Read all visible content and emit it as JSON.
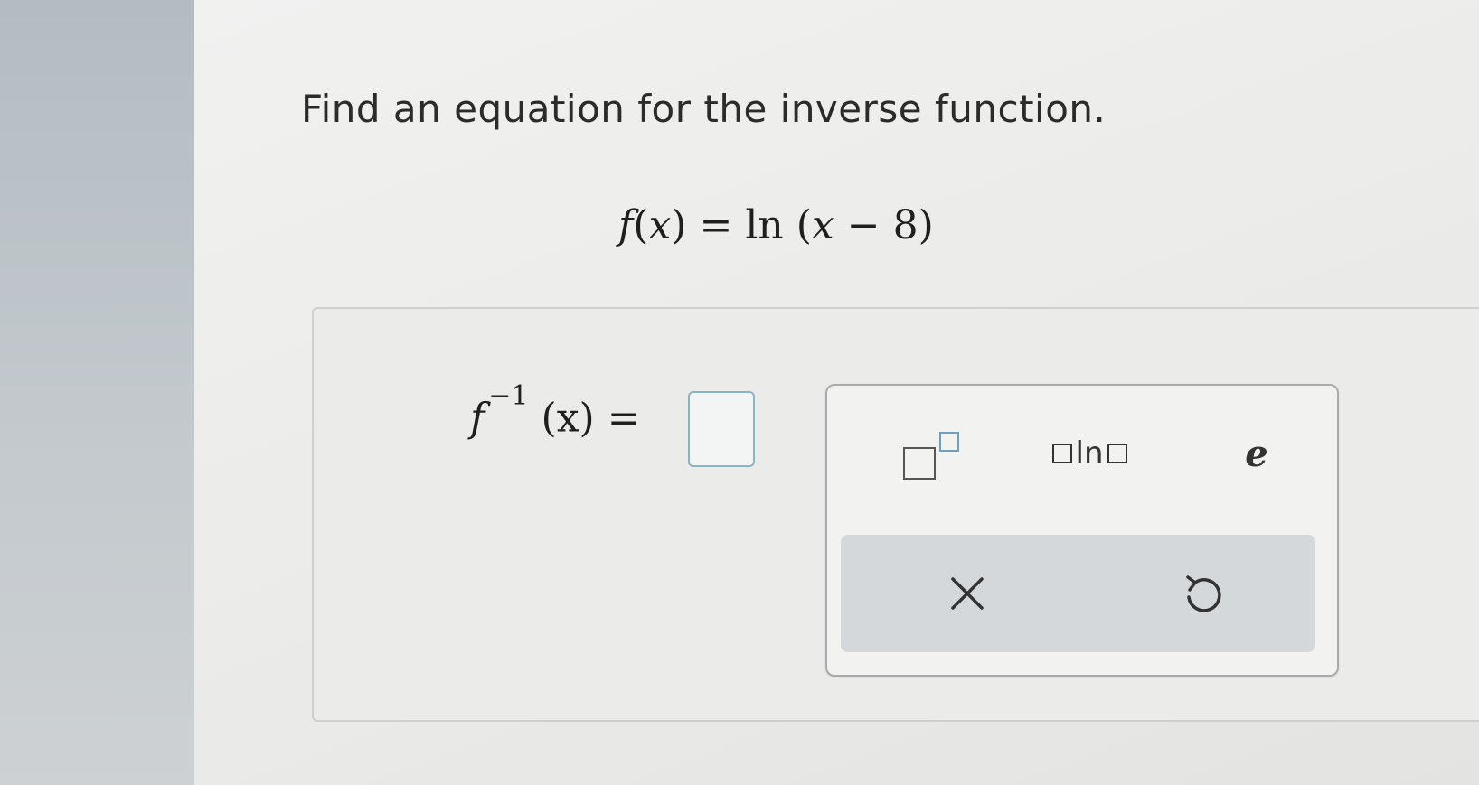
{
  "question": {
    "text": "Find an equation for the inverse function."
  },
  "given": {
    "f": "f",
    "lparen": "(",
    "x": "x",
    "rparen": ")",
    "equals": " = ",
    "ln": "ln",
    "lparen2": " (",
    "x2": "x",
    "minus": " − ",
    "eight": "8",
    "rparen2": ")"
  },
  "answer": {
    "f": "f",
    "exponent": "−1",
    "arg": "(x)",
    "equals": "=",
    "input_value": ""
  },
  "palette": {
    "log_label": "ln",
    "e_label": "e",
    "icons": [
      "superscript-template-icon",
      "logarithm-template-icon",
      "close-icon",
      "undo-icon"
    ]
  }
}
